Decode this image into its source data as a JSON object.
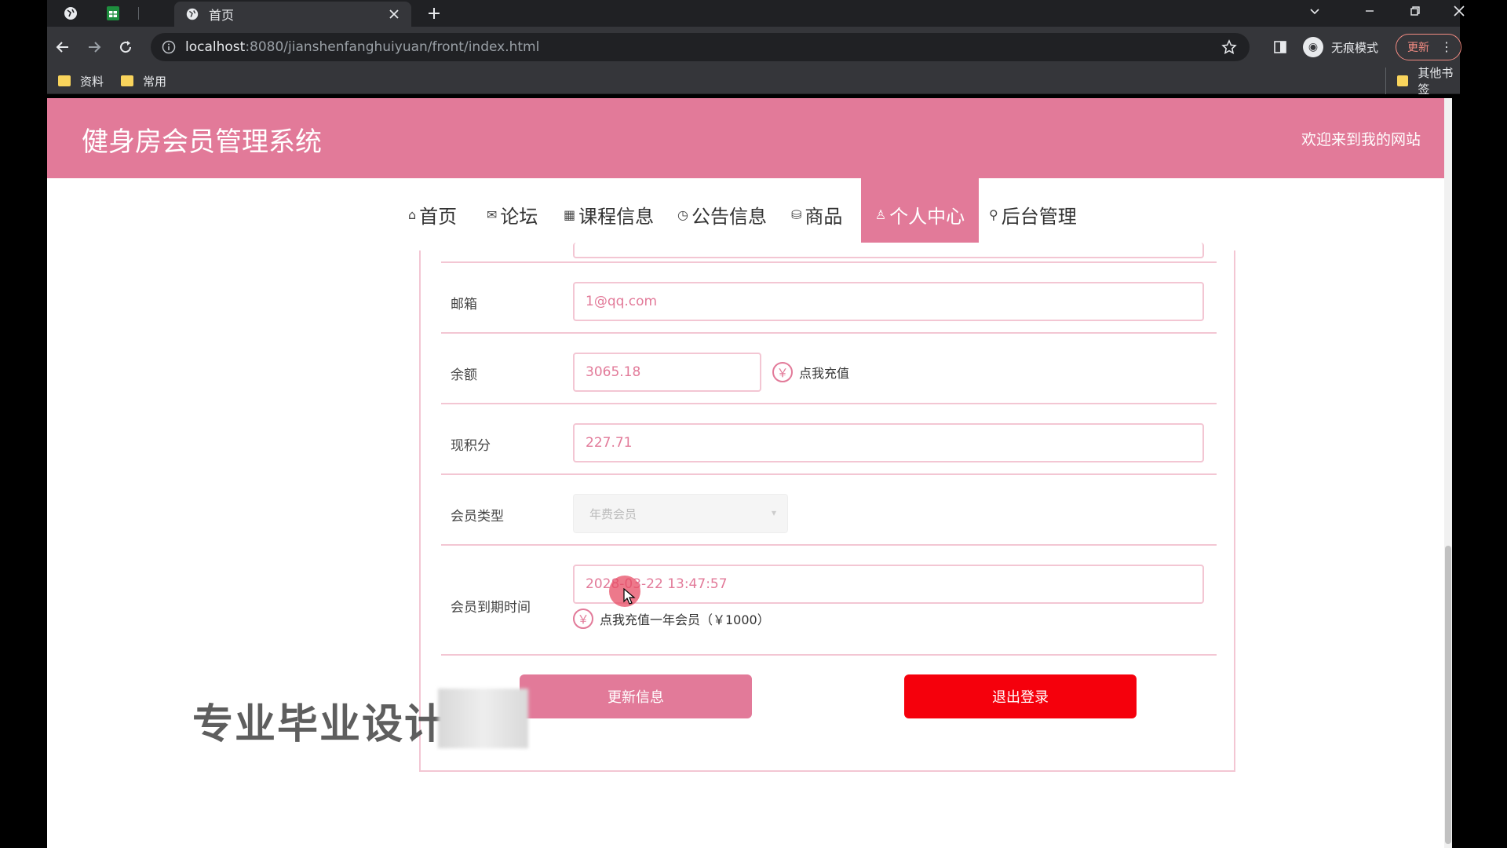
{
  "browser": {
    "tab_title": "首页",
    "url_host": "localhost",
    "url_path": ":8080/jianshenfanghuiyuan/front/index.html",
    "incognito_label": "无痕模式",
    "update_label": "更新",
    "bookmarks": [
      "资料",
      "常用"
    ],
    "other_bookmarks": "其他书签"
  },
  "site": {
    "title": "健身房会员管理系统",
    "welcome": "欢迎来到我的网站"
  },
  "nav": [
    {
      "icon": "⌂",
      "label": "首页"
    },
    {
      "icon": "✉",
      "label": "论坛"
    },
    {
      "icon": "▦",
      "label": "课程信息"
    },
    {
      "icon": "◷",
      "label": "公告信息"
    },
    {
      "icon": "⛁",
      "label": "商品"
    },
    {
      "icon": "♙",
      "label": "个人中心"
    },
    {
      "icon": "⚲",
      "label": "后台管理"
    }
  ],
  "form": {
    "email_label": "邮箱",
    "email_value": "1@qq.com",
    "balance_label": "余额",
    "balance_value": "3065.18",
    "recharge_label": "点我充值",
    "points_label": "现积分",
    "points_value": "227.71",
    "member_type_label": "会员类型",
    "member_type_value": "年费会员",
    "expire_label": "会员到期时间",
    "expire_value": "2028-03-22 13:47:57",
    "recharge_year_label": "点我充值一年会员（￥1000）",
    "yen_icon": "￥"
  },
  "buttons": {
    "update": "更新信息",
    "logout": "退出登录"
  },
  "overlay": {
    "watermark": "专业毕业设计"
  },
  "colors": {
    "brand": "#e27a99",
    "logout": "#f5000c"
  }
}
